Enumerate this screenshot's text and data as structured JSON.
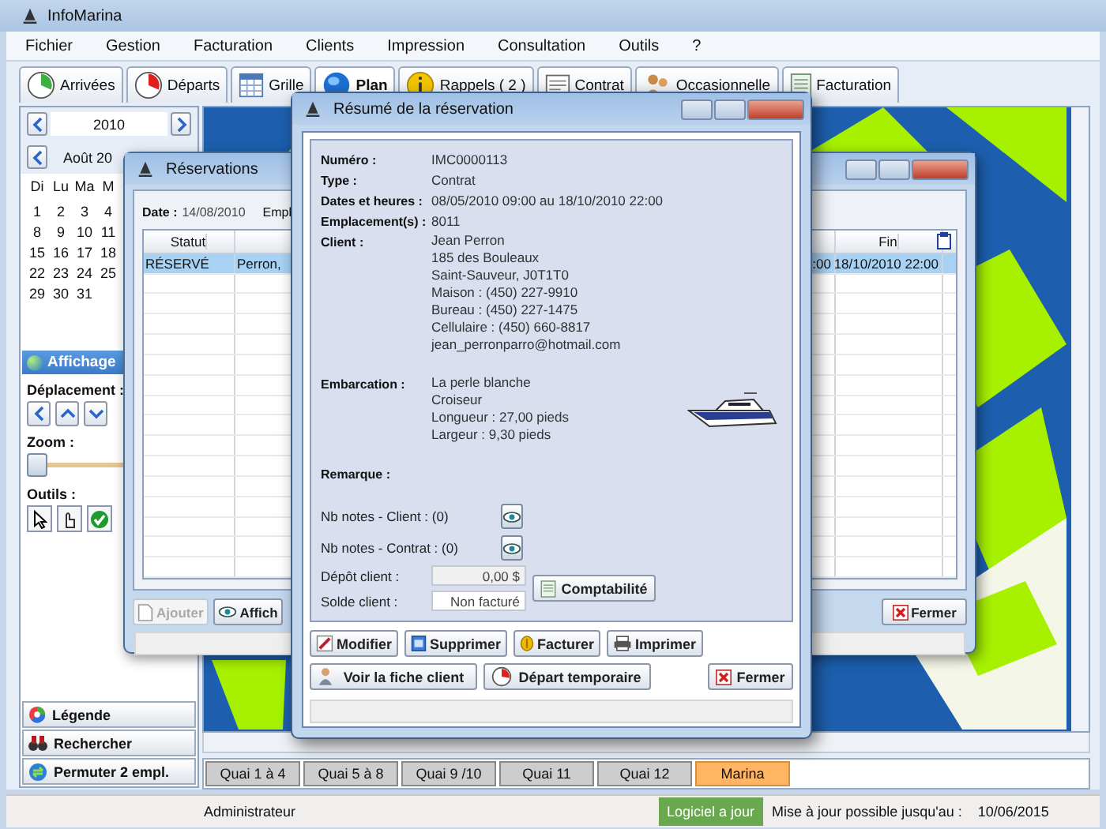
{
  "window": {
    "title": "InfoMarina"
  },
  "menu": [
    {
      "label": "Fichier"
    },
    {
      "label": "Gestion"
    },
    {
      "label": "Facturation"
    },
    {
      "label": "Clients"
    },
    {
      "label": "Impression"
    },
    {
      "label": "Consultation"
    },
    {
      "label": "Outils"
    },
    {
      "label": "?"
    }
  ],
  "tabs": [
    {
      "label": "Arrivées",
      "selected": false
    },
    {
      "label": "Départs",
      "selected": false
    },
    {
      "label": "Grille",
      "selected": false
    },
    {
      "label": "Plan",
      "selected": true
    },
    {
      "label": "Rappels ( 2 )",
      "selected": false
    },
    {
      "label": "Contrat",
      "selected": false
    },
    {
      "label": "Occasionnelle",
      "selected": false
    },
    {
      "label": "Facturation",
      "selected": false
    }
  ],
  "sidebar": {
    "year": "2010",
    "month": "Août 20",
    "weekdays": [
      "Di",
      "Lu",
      "Ma",
      "M"
    ],
    "weeks": [
      [
        "1",
        "2",
        "3",
        "4"
      ],
      [
        "8",
        "9",
        "10",
        "11"
      ],
      [
        "15",
        "16",
        "17",
        "18"
      ],
      [
        "22",
        "23",
        "24",
        "25"
      ],
      [
        "29",
        "30",
        "31"
      ]
    ],
    "display_title": "Affichage",
    "movement_label": "Déplacement :",
    "zoom_label": "Zoom :",
    "zoom": {
      "level": 0
    },
    "tools_label": "Outils :",
    "actions": [
      {
        "label": "Légende"
      },
      {
        "label": "Rechercher"
      },
      {
        "label": "Permuter 2 empl."
      }
    ]
  },
  "quai_tabs": [
    {
      "label": "Quai 1 à 4",
      "selected": false
    },
    {
      "label": "Quai 5 à 8",
      "selected": false
    },
    {
      "label": "Quai 9 /10",
      "selected": false
    },
    {
      "label": "Quai 11",
      "selected": false
    },
    {
      "label": "Quai 12",
      "selected": false
    },
    {
      "label": "Marina",
      "selected": true
    }
  ],
  "status_bar": {
    "user": "Administrateur",
    "update_status": "Logiciel a jour",
    "update_label": "Mise à jour possible jusqu'au :",
    "update_date": "10/06/2015"
  },
  "reservations_window": {
    "title": "Réservations",
    "date_label": "Date :",
    "date": "14/08/2010",
    "column_label": "Empl",
    "columns": [
      "Statut",
      "",
      "",
      "Fin"
    ],
    "rows": [
      {
        "cells": [
          "RÉSERVÉ",
          "Perron,",
          ":00",
          "18/10/2010 22:00"
        ],
        "selected": true
      }
    ],
    "buttons": [
      {
        "label": "Ajouter",
        "disabled": true
      },
      {
        "label": "Affich",
        "disabled": false
      }
    ],
    "close": "Fermer"
  },
  "summary_window": {
    "title": "Résumé de la réservation",
    "fields": [
      {
        "label": "Numéro :",
        "kind": "text",
        "lines": [
          "IMC0000113"
        ]
      },
      {
        "label": "Type :",
        "kind": "text",
        "lines": [
          "Contrat"
        ]
      },
      {
        "label": "Dates et heures :",
        "kind": "text",
        "lines": [
          "08/05/2010 09:00 au 18/10/2010 22:00"
        ]
      },
      {
        "label": "Emplacement(s) :",
        "kind": "text",
        "lines": [
          "8011"
        ]
      },
      {
        "label": "Client :",
        "kind": "text",
        "lines": [
          "Jean Perron",
          "185 des Bouleaux",
          "Saint-Sauveur, J0T1T0",
          "Maison : (450) 227-9910",
          "Bureau : (450) 227-1475",
          "Cellulaire : (450) 660-8817",
          "jean_perronparro@hotmail.com"
        ]
      },
      {
        "label": "Embarcation :",
        "kind": "vessel",
        "lines": [
          "La perle blanche",
          "Croiseur",
          "Longueur : 27,00 pieds",
          "Largeur : 9,30 pieds"
        ]
      },
      {
        "label": "Remarque :",
        "kind": "text"
      }
    ],
    "notes": [
      {
        "label": "Nb notes - Client : (0)"
      },
      {
        "label": "Nb notes - Contrat : (0)"
      }
    ],
    "money": [
      {
        "label": "Dépôt client :",
        "value": "0,00 $"
      },
      {
        "label": "Solde client :",
        "value": "Non facturé"
      }
    ],
    "accounting_button": "Comptabilité",
    "actions": [
      {
        "label": "Modifier"
      },
      {
        "label": "Supprimer"
      },
      {
        "label": "Facturer"
      },
      {
        "label": "Imprimer"
      }
    ],
    "actions_2": [
      {
        "label": "Voir la fiche client"
      },
      {
        "label": "Départ temporaire"
      }
    ],
    "close": "Fermer"
  }
}
